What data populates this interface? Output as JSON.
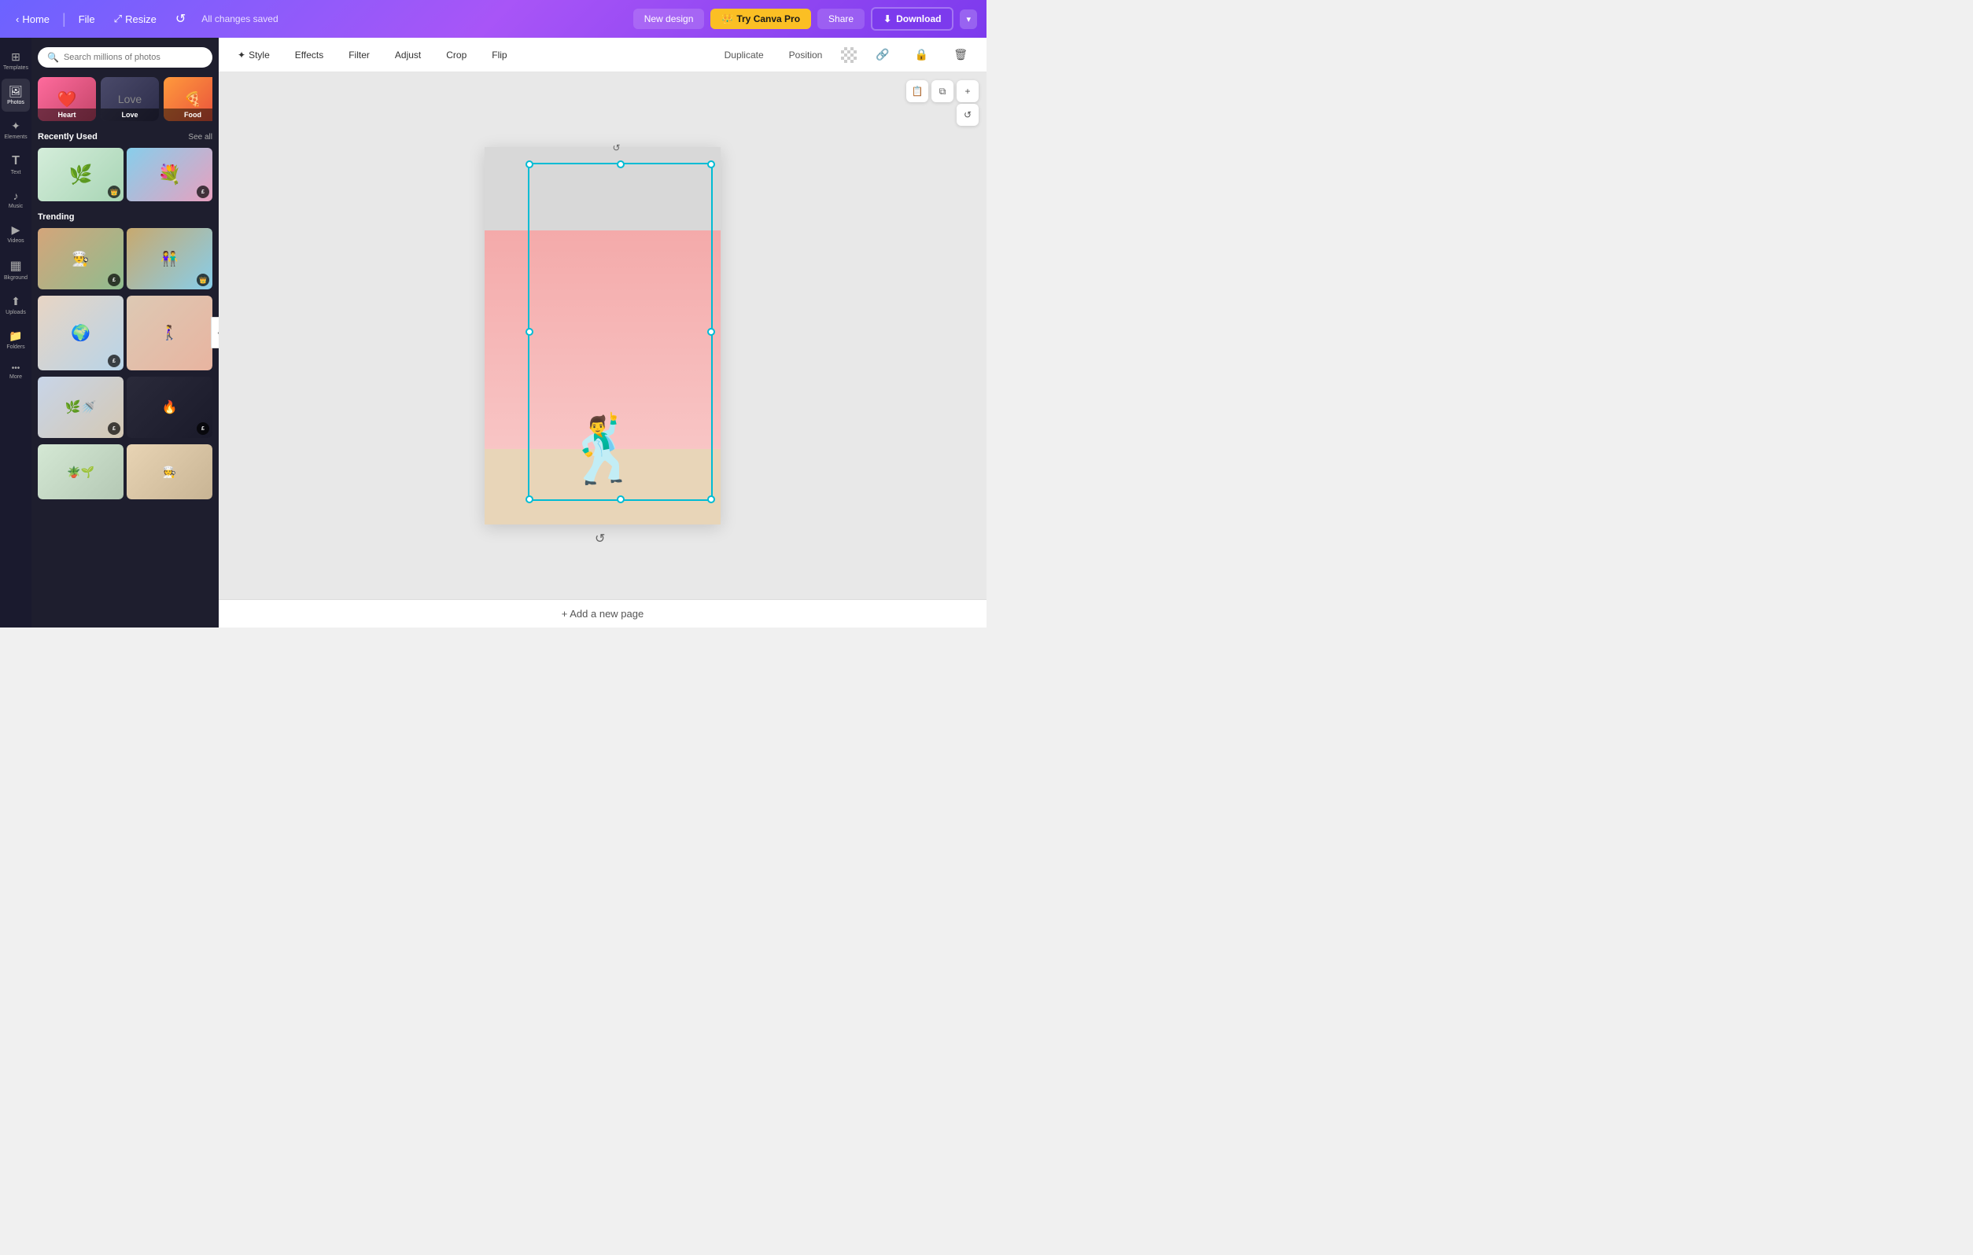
{
  "topNav": {
    "home": "Home",
    "file": "File",
    "resize": "Resize",
    "savedStatus": "All changes saved",
    "newDesign": "New design",
    "tryPro": "Try Canva Pro",
    "share": "Share",
    "download": "Download"
  },
  "sidebar": {
    "items": [
      {
        "id": "templates",
        "label": "Templates",
        "icon": "⊞"
      },
      {
        "id": "photos",
        "label": "Photos",
        "icon": "🖼"
      },
      {
        "id": "elements",
        "label": "Elements",
        "icon": "✦"
      },
      {
        "id": "text",
        "label": "Text",
        "icon": "T"
      },
      {
        "id": "music",
        "label": "Music",
        "icon": "♪"
      },
      {
        "id": "videos",
        "label": "Videos",
        "icon": "▶"
      },
      {
        "id": "background",
        "label": "Bkground",
        "icon": "◻"
      },
      {
        "id": "uploads",
        "label": "Uploads",
        "icon": "↑"
      },
      {
        "id": "folders",
        "label": "Folders",
        "icon": "📁"
      },
      {
        "id": "more",
        "label": "More",
        "icon": "•••"
      }
    ]
  },
  "photosPanel": {
    "searchPlaceholder": "Search millions of photos",
    "categories": [
      {
        "id": "heart",
        "label": "Heart"
      },
      {
        "id": "love",
        "label": "Love"
      },
      {
        "id": "food",
        "label": "Food"
      }
    ],
    "recentlyUsed": {
      "title": "Recently Used",
      "seeAll": "See all"
    },
    "trending": {
      "title": "Trending"
    }
  },
  "toolbar": {
    "style": "Style",
    "effects": "Effects",
    "filter": "Filter",
    "adjust": "Adjust",
    "crop": "Crop",
    "flip": "Flip",
    "duplicate": "Duplicate",
    "position": "Position"
  },
  "canvas": {
    "addPage": "+ Add a new page"
  }
}
